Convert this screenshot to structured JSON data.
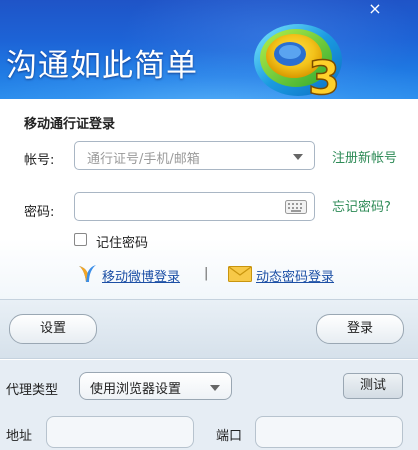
{
  "header": {
    "title": "沟通如此简单",
    "close_label": "×"
  },
  "login": {
    "section_title": "移动通行证登录",
    "account_label": "帐号:",
    "account_placeholder": "通行证号/手机/邮箱",
    "register_link": "注册新帐号",
    "password_label": "密码:",
    "forgot_link": "忘记密码?",
    "remember_label": "记住密码",
    "weibo_link": "移动微博登录",
    "separator": "|",
    "dynamic_link": "动态密码登录"
  },
  "buttons": {
    "settings_label": "设置",
    "login_label": "登录"
  },
  "proxy": {
    "type_label": "代理类型",
    "type_value": "使用浏览器设置",
    "test_label": "测试",
    "address_label": "地址",
    "port_label": "端口"
  },
  "colors": {
    "banner_blue": "#1d63d6",
    "link_green": "#2e8b57",
    "link_blue": "#1c4fa5"
  }
}
